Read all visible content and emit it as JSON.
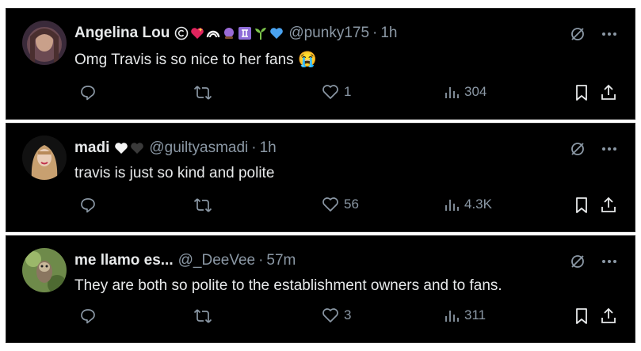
{
  "colors": {
    "card_bg": "#000000",
    "text": "#e7e9ea",
    "muted": "#8b98a5"
  },
  "tweets": [
    {
      "name": "Angelina Lou",
      "handle": "@punky175",
      "separator": "·",
      "time": "1h",
      "text": "Omg Travis is so nice to her fans 😭",
      "badges": [
        "copyright-icon",
        "heart-icon",
        "rainbow-icon",
        "crystal-ball-icon",
        "gemini-icon",
        "seedling-icon",
        "blue-heart-icon"
      ],
      "stats": {
        "replies": "",
        "retweets": "",
        "likes": "1",
        "views": "304"
      }
    },
    {
      "name": "madi",
      "handle": "@guiltyasmadi",
      "separator": "·",
      "time": "1h",
      "text": "travis is just so kind and polite",
      "badges": [
        "white-heart-icon",
        "black-heart-icon"
      ],
      "stats": {
        "replies": "",
        "retweets": "",
        "likes": "56",
        "views": "4.3K"
      }
    },
    {
      "name": "me llamo es...",
      "handle": "@_DeeVee",
      "separator": "·",
      "time": "57m",
      "text": "They are both so polite to the establishment owners and to fans.",
      "badges": [],
      "stats": {
        "replies": "",
        "retweets": "",
        "likes": "3",
        "views": "311"
      }
    }
  ]
}
